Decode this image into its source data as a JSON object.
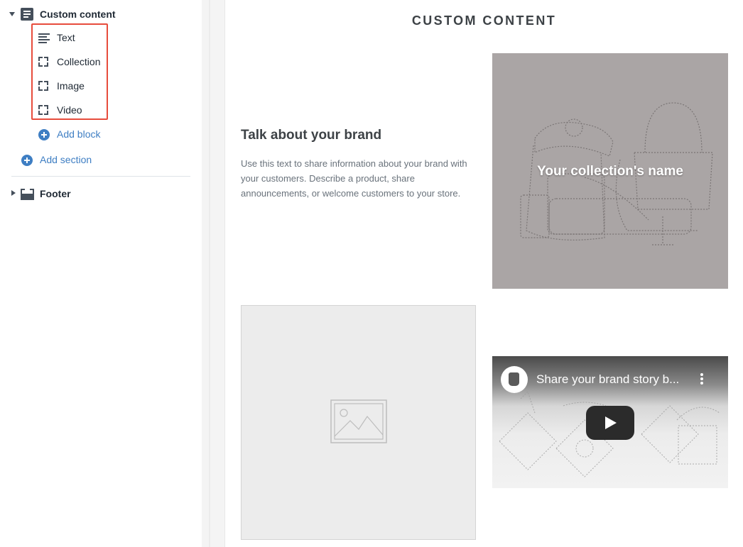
{
  "sidebar": {
    "custom_section": {
      "label": "Custom content"
    },
    "blocks": [
      {
        "label": "Text",
        "icon": "text-lines-icon"
      },
      {
        "label": "Collection",
        "icon": "dashed-square-icon"
      },
      {
        "label": "Image",
        "icon": "dashed-square-icon"
      },
      {
        "label": "Video",
        "icon": "dashed-square-icon"
      }
    ],
    "add_block": "Add block",
    "add_section": "Add section",
    "footer_section": {
      "label": "Footer"
    }
  },
  "preview": {
    "title": "CUSTOM CONTENT",
    "text_block": {
      "heading": "Talk about your brand",
      "body": "Use this text to share information about your brand with your customers. Describe a product, share announcements, or welcome customers to your store."
    },
    "collection": {
      "name": "Your collection's name"
    },
    "video": {
      "title": "Share your brand story b..."
    }
  },
  "colors": {
    "accent": "#3e7ec3",
    "highlight": "#e74c3c",
    "collection_bg": "#aaa5a5"
  }
}
